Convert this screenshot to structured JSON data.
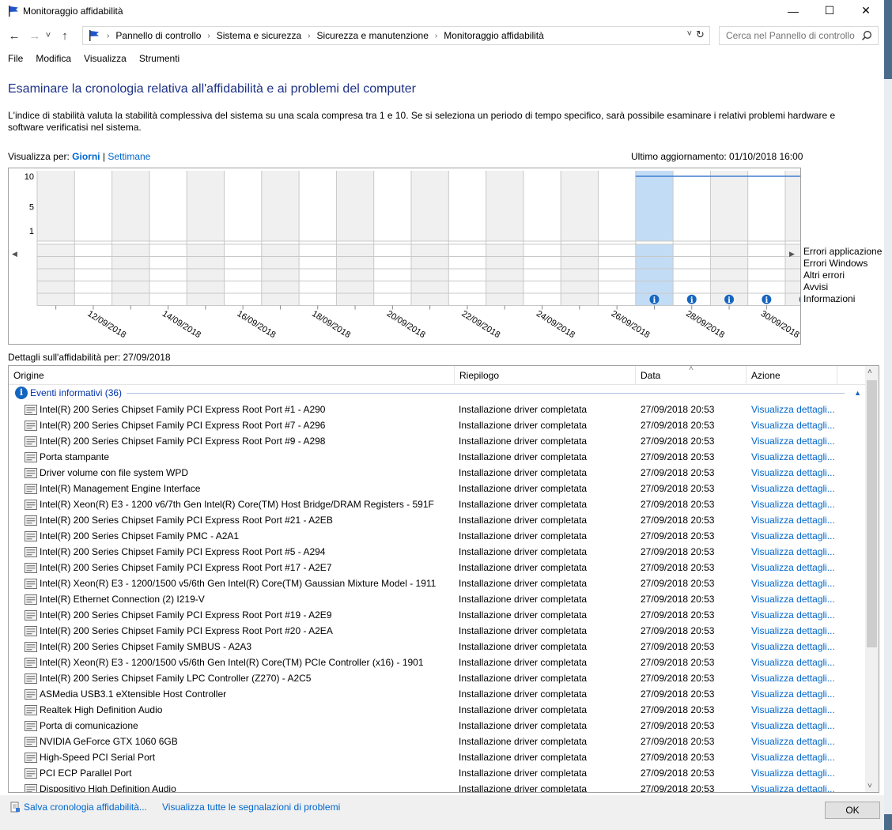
{
  "window": {
    "title": "Monitoraggio affidabilità",
    "minimize": "—",
    "maximize": "☐",
    "close": "✕"
  },
  "nav": {
    "back": "←",
    "forward": "→",
    "recent": "˅",
    "up": "↑",
    "breadcrumbs": [
      "Pannello di controllo",
      "Sistema e sicurezza",
      "Sicurezza e manutenzione",
      "Monitoraggio affidabilità"
    ],
    "separator": "›",
    "dropdown": "˅",
    "refresh": "↻"
  },
  "search": {
    "placeholder": "Cerca nel Pannello di controllo"
  },
  "menu": [
    "File",
    "Modifica",
    "Visualizza",
    "Strumenti"
  ],
  "page": {
    "heading": "Esaminare la cronologia relativa all'affidabilità e ai problemi del computer",
    "description": "L'indice di stabilità valuta la stabilità complessiva del sistema su una scala compresa tra 1 e 10. Se si seleziona un periodo di tempo specifico, sarà possibile esaminare i relativi problemi hardware e software verificatisi nel sistema.",
    "view_by_label": "Visualizza per:",
    "view_days": "Giorni",
    "view_sep": "|",
    "view_weeks": "Settimane",
    "last_update": "Ultimo aggiornamento: 01/10/2018 16:00",
    "details_label": "Dettagli sull'affidabilità per: 27/09/2018"
  },
  "chart_data": {
    "type": "line",
    "y_ticks": [
      "10",
      "5",
      "1"
    ],
    "ylim": [
      1,
      10
    ],
    "x_labels": [
      "12/09/2018",
      "14/09/2018",
      "16/09/2018",
      "18/09/2018",
      "20/09/2018",
      "22/09/2018",
      "24/09/2018",
      "26/09/2018",
      "28/09/2018",
      "30/09/2018"
    ],
    "days": [
      "11/09",
      "12/09",
      "13/09",
      "14/09",
      "15/09",
      "16/09",
      "17/09",
      "18/09",
      "19/09",
      "20/09",
      "21/09",
      "22/09",
      "23/09",
      "24/09",
      "25/09",
      "26/09",
      "27/09",
      "28/09",
      "29/09",
      "30/09",
      "01/10"
    ],
    "stability_index": [
      null,
      null,
      null,
      null,
      null,
      null,
      null,
      null,
      null,
      null,
      null,
      null,
      null,
      null,
      null,
      null,
      10,
      10,
      10,
      10,
      10
    ],
    "selected_day_index": 16,
    "info_events_day_indices": [
      16,
      17,
      18,
      19,
      20
    ],
    "info_icon_glyph": "i",
    "legend": [
      "Errori applicazione",
      "Errori Windows",
      "Altri errori",
      "Avvisi",
      "Informazioni"
    ],
    "scroll_left": "◀",
    "scroll_right": "▶",
    "colors": {
      "selected": "#c3dcf5",
      "shaded": "#f0f0f0",
      "line": "#3f7fd0",
      "info": "#1565c0",
      "grid": "#c8c8c8"
    }
  },
  "table": {
    "columns": [
      "Origine",
      "Riepilogo",
      "Data",
      "Azione"
    ],
    "sort_caret": "˄",
    "group": {
      "label": "Eventi informativi (36)",
      "icon": "i",
      "chevron": "▲"
    },
    "rows": [
      {
        "origin": "Intel(R) 200 Series Chipset Family PCI Express Root Port #1 - A290",
        "summary": "Installazione driver completata",
        "date": "27/09/2018 20:53",
        "action": "Visualizza dettagli..."
      },
      {
        "origin": "Intel(R) 200 Series Chipset Family PCI Express Root Port #7 - A296",
        "summary": "Installazione driver completata",
        "date": "27/09/2018 20:53",
        "action": "Visualizza dettagli..."
      },
      {
        "origin": "Intel(R) 200 Series Chipset Family PCI Express Root Port #9 - A298",
        "summary": "Installazione driver completata",
        "date": "27/09/2018 20:53",
        "action": "Visualizza dettagli..."
      },
      {
        "origin": "Porta stampante",
        "summary": "Installazione driver completata",
        "date": "27/09/2018 20:53",
        "action": "Visualizza dettagli..."
      },
      {
        "origin": "Driver volume con file system WPD",
        "summary": "Installazione driver completata",
        "date": "27/09/2018 20:53",
        "action": "Visualizza dettagli..."
      },
      {
        "origin": "Intel(R) Management Engine Interface",
        "summary": "Installazione driver completata",
        "date": "27/09/2018 20:53",
        "action": "Visualizza dettagli..."
      },
      {
        "origin": "Intel(R) Xeon(R) E3 - 1200 v6/7th Gen Intel(R) Core(TM) Host Bridge/DRAM Registers - 591F",
        "summary": "Installazione driver completata",
        "date": "27/09/2018 20:53",
        "action": "Visualizza dettagli..."
      },
      {
        "origin": "Intel(R) 200 Series Chipset Family PCI Express Root Port #21 - A2EB",
        "summary": "Installazione driver completata",
        "date": "27/09/2018 20:53",
        "action": "Visualizza dettagli..."
      },
      {
        "origin": "Intel(R) 200 Series Chipset Family PMC - A2A1",
        "summary": "Installazione driver completata",
        "date": "27/09/2018 20:53",
        "action": "Visualizza dettagli..."
      },
      {
        "origin": "Intel(R) 200 Series Chipset Family PCI Express Root Port #5 - A294",
        "summary": "Installazione driver completata",
        "date": "27/09/2018 20:53",
        "action": "Visualizza dettagli..."
      },
      {
        "origin": "Intel(R) 200 Series Chipset Family PCI Express Root Port #17 - A2E7",
        "summary": "Installazione driver completata",
        "date": "27/09/2018 20:53",
        "action": "Visualizza dettagli..."
      },
      {
        "origin": "Intel(R) Xeon(R) E3 - 1200/1500 v5/6th Gen Intel(R) Core(TM) Gaussian Mixture Model - 1911",
        "summary": "Installazione driver completata",
        "date": "27/09/2018 20:53",
        "action": "Visualizza dettagli..."
      },
      {
        "origin": "Intel(R) Ethernet Connection (2) I219-V",
        "summary": "Installazione driver completata",
        "date": "27/09/2018 20:53",
        "action": "Visualizza dettagli..."
      },
      {
        "origin": "Intel(R) 200 Series Chipset Family PCI Express Root Port #19 - A2E9",
        "summary": "Installazione driver completata",
        "date": "27/09/2018 20:53",
        "action": "Visualizza dettagli..."
      },
      {
        "origin": "Intel(R) 200 Series Chipset Family PCI Express Root Port #20 - A2EA",
        "summary": "Installazione driver completata",
        "date": "27/09/2018 20:53",
        "action": "Visualizza dettagli..."
      },
      {
        "origin": "Intel(R) 200 Series Chipset Family SMBUS - A2A3",
        "summary": "Installazione driver completata",
        "date": "27/09/2018 20:53",
        "action": "Visualizza dettagli..."
      },
      {
        "origin": "Intel(R) Xeon(R) E3 - 1200/1500 v5/6th Gen Intel(R) Core(TM) PCIe Controller (x16) - 1901",
        "summary": "Installazione driver completata",
        "date": "27/09/2018 20:53",
        "action": "Visualizza dettagli..."
      },
      {
        "origin": "Intel(R) 200 Series Chipset Family LPC Controller (Z270) - A2C5",
        "summary": "Installazione driver completata",
        "date": "27/09/2018 20:53",
        "action": "Visualizza dettagli..."
      },
      {
        "origin": "ASMedia USB3.1 eXtensible Host Controller",
        "summary": "Installazione driver completata",
        "date": "27/09/2018 20:53",
        "action": "Visualizza dettagli..."
      },
      {
        "origin": "Realtek High Definition Audio",
        "summary": "Installazione driver completata",
        "date": "27/09/2018 20:53",
        "action": "Visualizza dettagli..."
      },
      {
        "origin": "Porta di comunicazione",
        "summary": "Installazione driver completata",
        "date": "27/09/2018 20:53",
        "action": "Visualizza dettagli..."
      },
      {
        "origin": "NVIDIA GeForce GTX 1060 6GB",
        "summary": "Installazione driver completata",
        "date": "27/09/2018 20:53",
        "action": "Visualizza dettagli..."
      },
      {
        "origin": "High-Speed PCI Serial Port",
        "summary": "Installazione driver completata",
        "date": "27/09/2018 20:53",
        "action": "Visualizza dettagli..."
      },
      {
        "origin": "PCI ECP Parallel Port",
        "summary": "Installazione driver completata",
        "date": "27/09/2018 20:53",
        "action": "Visualizza dettagli..."
      },
      {
        "origin": "Dispositivo High Definition Audio",
        "summary": "Installazione driver completata",
        "date": "27/09/2018 20:53",
        "action": "Visualizza dettagli..."
      }
    ],
    "scroll_up": "˄",
    "scroll_down": "˅"
  },
  "footer": {
    "save_link": "Salva cronologia affidabilità...",
    "view_all_link": "Visualizza tutte le segnalazioni di problemi",
    "ok_label": "OK"
  }
}
